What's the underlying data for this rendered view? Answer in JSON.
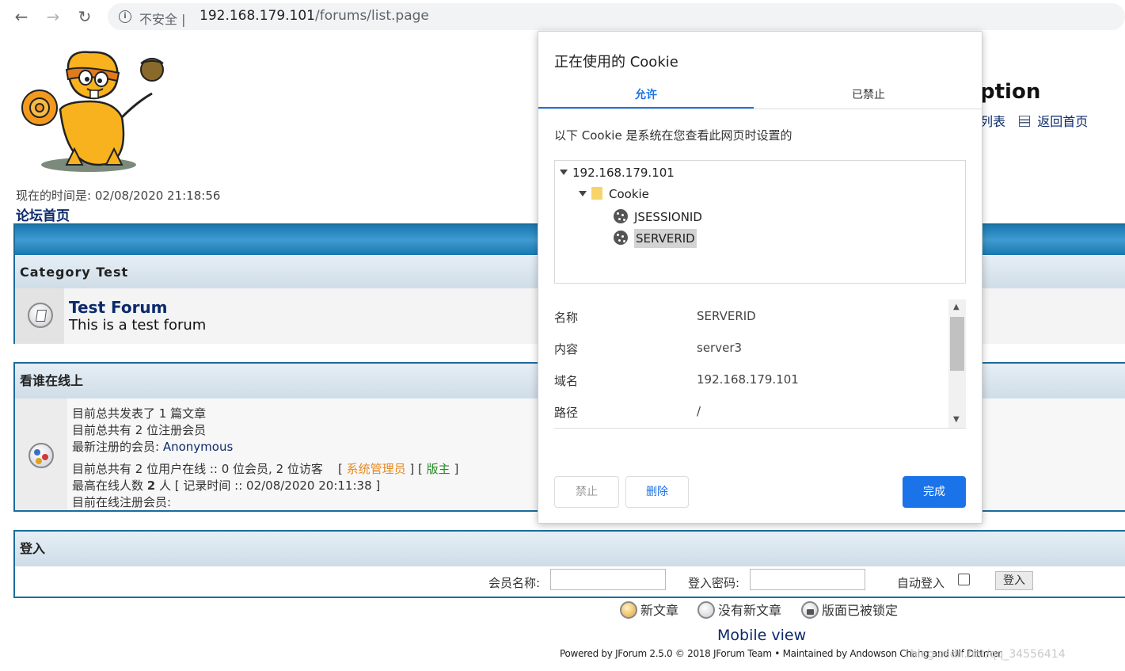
{
  "browser": {
    "insecure_label": "不安全",
    "url_host": "192.168.179.101",
    "url_path": "/forums/list.page",
    "icons": [
      "back-arrow-icon",
      "forward-arrow-icon",
      "reload-icon",
      "info-icon"
    ]
  },
  "page": {
    "time_label": "现在的时间是: 02/08/2020 21:18:56",
    "home_link": "论坛首页",
    "heading_partial": "ption",
    "links": [
      "列表",
      "返回首页"
    ],
    "category": {
      "name": "Category Test",
      "forum_title": "Test Forum",
      "forum_desc": "This is a test forum"
    },
    "online": {
      "title": "看谁在线上",
      "line1": "目前总共发表了 1 篇文章",
      "line2": "目前总共有 2 位注册会员",
      "line3_label": "最新注册的会员: ",
      "line3_value": "Anonymous",
      "line4": "目前总共有 2 位用户在线 :: 0 位会员, 2 位访客",
      "legend_open": "[",
      "legend_admin": "系统管理员",
      "legend_mid": "] [",
      "legend_mod": "版主",
      "legend_close": "]",
      "line5_a": "最高在线人数 ",
      "line5_num": "2",
      "line5_b": " 人 [ 记录时间 :: 02/08/2020 20:11:38 ]",
      "line6": "目前在线注册会员:"
    },
    "login": {
      "title": "登入",
      "username_label": "会员名称:",
      "password_label": "登入密码:",
      "auto_login_label": "自动登入",
      "auto_login_checked": false,
      "submit_label": "登入"
    },
    "legend": {
      "new_posts": "新文章",
      "no_new_posts": "没有新文章",
      "locked": "版面已被锁定"
    },
    "mobile_view": "Mobile view",
    "powered": "Powered by JForum 2.5.0 © 2018 JForum Team • Maintained by Andowson Chang and Ulf Dittmer",
    "watermark": "blog.csdn.net/qq_34556414"
  },
  "cookie_dialog": {
    "title": "正在使用的 Cookie",
    "tabs": [
      "允许",
      "已禁止"
    ],
    "active_tab": "允许",
    "description": "以下 Cookie 是系统在您查看此网页时设置的",
    "tree": {
      "host": "192.168.179.101",
      "folder": "Cookie",
      "items": [
        "JSESSIONID",
        "SERVERID"
      ],
      "selected": "SERVERID"
    },
    "details": [
      {
        "key": "名称",
        "value": "SERVERID"
      },
      {
        "key": "内容",
        "value": "server3"
      },
      {
        "key": "域名",
        "value": "192.168.179.101"
      },
      {
        "key": "路径",
        "value": "/"
      }
    ],
    "buttons": {
      "block": "禁止",
      "delete": "删除",
      "done": "完成"
    }
  },
  "colors": {
    "accent_blue": "#1a73e8",
    "forum_border": "#1b6c9b",
    "link_navy": "#0b2a6b",
    "admin_orange": "#e8891e",
    "moderator_green": "#228b22"
  }
}
